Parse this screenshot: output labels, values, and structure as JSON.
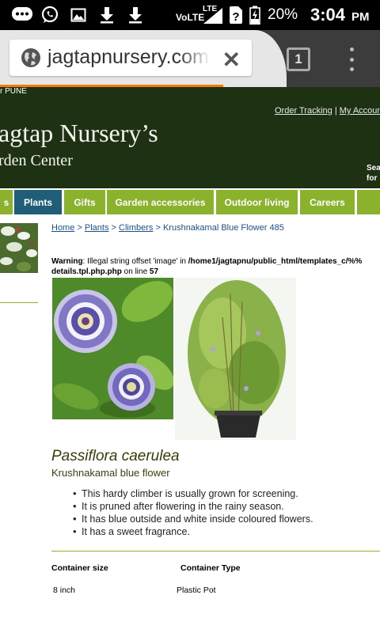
{
  "status_bar": {
    "network": "VoLTE",
    "lte": "LTE",
    "battery": "20%",
    "time": "3:04",
    "ampm": "PM"
  },
  "browser": {
    "url": "jagtapnursery.com",
    "tab_count": "1"
  },
  "header": {
    "city": "r PUNE",
    "order_tracking": "Order Tracking",
    "separator": "|",
    "my_account": "My Accoun",
    "brand": "agtap Nursery’s",
    "brand_sub": "rden Center",
    "search_line1": "Sea",
    "search_line2": "for"
  },
  "nav": {
    "items": [
      {
        "label": "s"
      },
      {
        "label": "Plants"
      },
      {
        "label": "Gifts"
      },
      {
        "label": "Garden accessories"
      },
      {
        "label": "Outdoor living"
      },
      {
        "label": "Careers"
      },
      {
        "label": ""
      }
    ]
  },
  "breadcrumb": {
    "home": "Home",
    "sep1": " > ",
    "plants": "Plants",
    "sep2": " > ",
    "climbers": "Climbers",
    "current": " > Krushnakamal Blue Flower 485"
  },
  "warning": {
    "label": "Warning",
    "message": ": Illegal string offset 'image' in ",
    "path": "/home1/jagtapnu/public_html/templates_c/%%",
    "file": "details.tpl.php.php",
    "on_line": " on line ",
    "line": "57"
  },
  "product": {
    "scientific_name": "Passiflora caerulea",
    "common_name": "Krushnakamal blue flower",
    "features": [
      "This hardy climber is usually grown for screening.",
      "It is pruned after flowering in the rainy season.",
      "It has blue outside and white inside coloured flowers.",
      "It has a sweet fragrance."
    ]
  },
  "specs": {
    "container_size_label": "Container size",
    "container_type_label": "Container Type",
    "container_size": "8 inch",
    "container_type": "Plastic Pot"
  },
  "colors": {
    "header_bg": "#1e3113",
    "nav_green": "#8bb22d",
    "nav_active": "#1f5d78",
    "link_blue": "#1c4f8c",
    "progress_orange": "#f57c00"
  }
}
